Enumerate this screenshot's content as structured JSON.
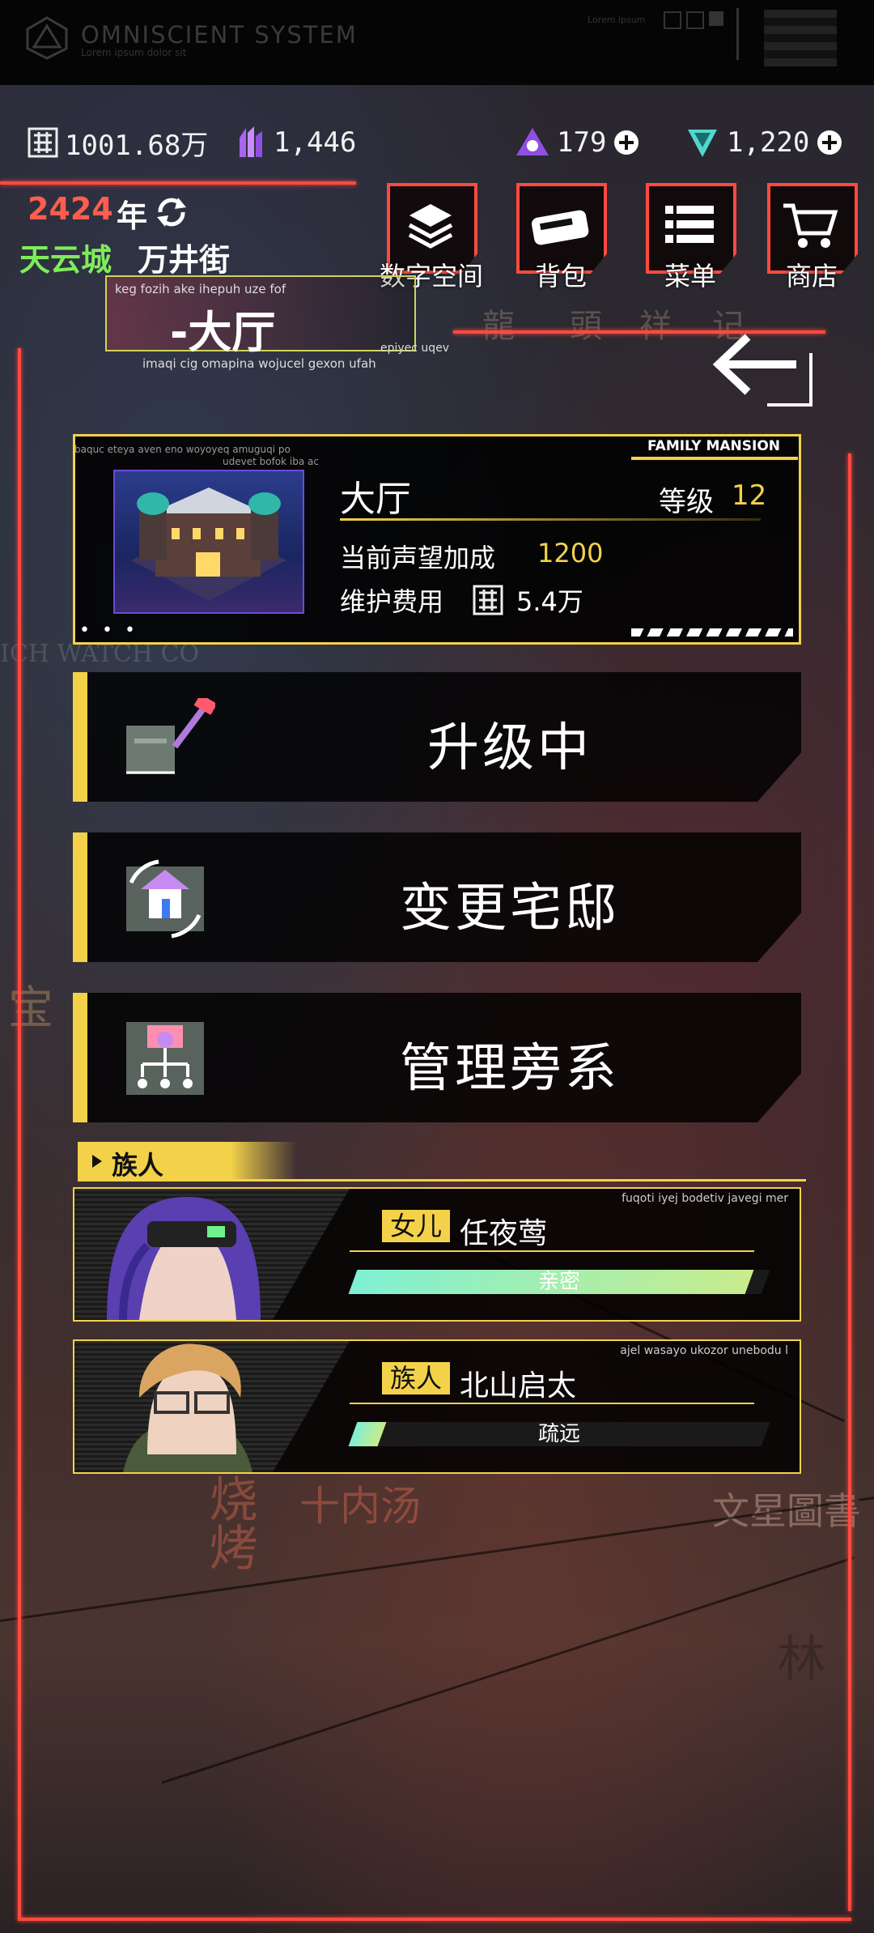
{
  "system": {
    "name": "OMNISCIENT  SYSTEM",
    "subtitle": "Lorem ipsum dolor sit",
    "tiny": "Lorem ipsum"
  },
  "resources": {
    "money": "1001.68万",
    "gems": "1,446",
    "tokens": "179",
    "diamonds": "1,220"
  },
  "date": {
    "year": "2424",
    "year_suffix": "年"
  },
  "location": {
    "city": "天云城",
    "street": "万井街"
  },
  "nav": {
    "digital": "数字空间",
    "bag": "背包",
    "menu": "菜单",
    "shop": "商店"
  },
  "room": {
    "title": "-大厅",
    "small1": "keg fozih ake ihepuh uze fof",
    "small2": "imaqi cig omapina wojucel gexon ufah",
    "small3": "epiyec uqev"
  },
  "card": {
    "tag": "FAMILY MANSION",
    "small1": "baquc eteya aven eno woyoyeq amuguqi po",
    "small2": "udevet bofok iba ac",
    "name": "大厅",
    "level_label": "等级",
    "level": "12",
    "reputation_label": "当前声望加成",
    "reputation": "1200",
    "fee_label": "维护费用",
    "fee": "5.4万",
    "dots": "• • •"
  },
  "actions": {
    "upgrade": "升级中",
    "change": "变更宅邸",
    "manage": "管理旁系"
  },
  "clan": {
    "header": "族人",
    "members": [
      {
        "tag": "女儿",
        "name": "任夜莺",
        "relation": "亲密",
        "affinity": 0.96,
        "small": "fuqoti iyej bodetiv javegi mer"
      },
      {
        "tag": "族人",
        "name": "北山启太",
        "relation": "疏远",
        "affinity": 0.07,
        "small": "ajel wasayo ukozor unebodu l"
      }
    ]
  },
  "signs": [
    "龍",
    "頭",
    "祥",
    "记",
    "十内汤",
    "文星圖書",
    "烧烤",
    "林",
    "宝",
    "ICH WATCH CO"
  ],
  "colors": {
    "accent": "#f3d24a",
    "frame": "#ff4a3f",
    "city": "#7eec5a",
    "year": "#ff5d4d",
    "bar": "#7ff0d4"
  }
}
